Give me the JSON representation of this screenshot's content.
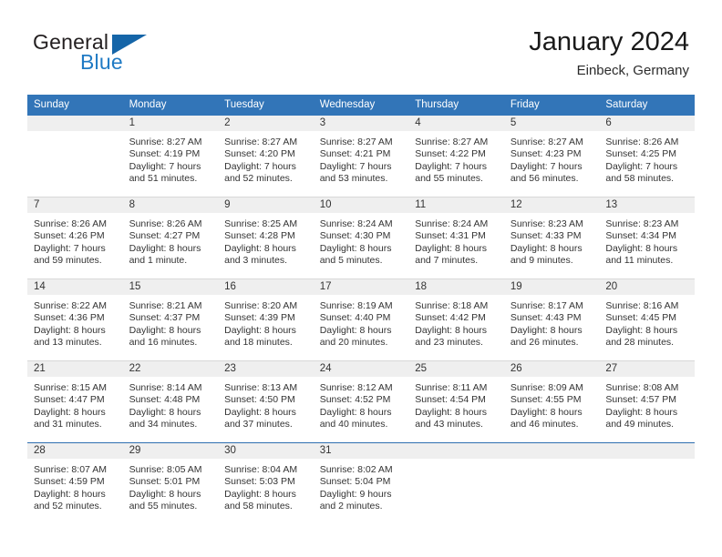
{
  "brand": {
    "name_part1": "General",
    "name_part2": "Blue",
    "accent_color": "#1f7ac4",
    "logo_icon": "triangle-logo-icon"
  },
  "header": {
    "title": "January 2024",
    "subtitle": "Einbeck, Germany"
  },
  "calendar": {
    "header_bg": "#3275b8",
    "daynum_bg": "#efefef",
    "weekday_headers": [
      "Sunday",
      "Monday",
      "Tuesday",
      "Wednesday",
      "Thursday",
      "Friday",
      "Saturday"
    ],
    "weeks": [
      [
        {
          "day": "",
          "sunrise": "",
          "sunset": "",
          "daylight_line1": "",
          "daylight_line2": ""
        },
        {
          "day": "1",
          "sunrise": "Sunrise: 8:27 AM",
          "sunset": "Sunset: 4:19 PM",
          "daylight_line1": "Daylight: 7 hours",
          "daylight_line2": "and 51 minutes."
        },
        {
          "day": "2",
          "sunrise": "Sunrise: 8:27 AM",
          "sunset": "Sunset: 4:20 PM",
          "daylight_line1": "Daylight: 7 hours",
          "daylight_line2": "and 52 minutes."
        },
        {
          "day": "3",
          "sunrise": "Sunrise: 8:27 AM",
          "sunset": "Sunset: 4:21 PM",
          "daylight_line1": "Daylight: 7 hours",
          "daylight_line2": "and 53 minutes."
        },
        {
          "day": "4",
          "sunrise": "Sunrise: 8:27 AM",
          "sunset": "Sunset: 4:22 PM",
          "daylight_line1": "Daylight: 7 hours",
          "daylight_line2": "and 55 minutes."
        },
        {
          "day": "5",
          "sunrise": "Sunrise: 8:27 AM",
          "sunset": "Sunset: 4:23 PM",
          "daylight_line1": "Daylight: 7 hours",
          "daylight_line2": "and 56 minutes."
        },
        {
          "day": "6",
          "sunrise": "Sunrise: 8:26 AM",
          "sunset": "Sunset: 4:25 PM",
          "daylight_line1": "Daylight: 7 hours",
          "daylight_line2": "and 58 minutes."
        }
      ],
      [
        {
          "day": "7",
          "sunrise": "Sunrise: 8:26 AM",
          "sunset": "Sunset: 4:26 PM",
          "daylight_line1": "Daylight: 7 hours",
          "daylight_line2": "and 59 minutes."
        },
        {
          "day": "8",
          "sunrise": "Sunrise: 8:26 AM",
          "sunset": "Sunset: 4:27 PM",
          "daylight_line1": "Daylight: 8 hours",
          "daylight_line2": "and 1 minute."
        },
        {
          "day": "9",
          "sunrise": "Sunrise: 8:25 AM",
          "sunset": "Sunset: 4:28 PM",
          "daylight_line1": "Daylight: 8 hours",
          "daylight_line2": "and 3 minutes."
        },
        {
          "day": "10",
          "sunrise": "Sunrise: 8:24 AM",
          "sunset": "Sunset: 4:30 PM",
          "daylight_line1": "Daylight: 8 hours",
          "daylight_line2": "and 5 minutes."
        },
        {
          "day": "11",
          "sunrise": "Sunrise: 8:24 AM",
          "sunset": "Sunset: 4:31 PM",
          "daylight_line1": "Daylight: 8 hours",
          "daylight_line2": "and 7 minutes."
        },
        {
          "day": "12",
          "sunrise": "Sunrise: 8:23 AM",
          "sunset": "Sunset: 4:33 PM",
          "daylight_line1": "Daylight: 8 hours",
          "daylight_line2": "and 9 minutes."
        },
        {
          "day": "13",
          "sunrise": "Sunrise: 8:23 AM",
          "sunset": "Sunset: 4:34 PM",
          "daylight_line1": "Daylight: 8 hours",
          "daylight_line2": "and 11 minutes."
        }
      ],
      [
        {
          "day": "14",
          "sunrise": "Sunrise: 8:22 AM",
          "sunset": "Sunset: 4:36 PM",
          "daylight_line1": "Daylight: 8 hours",
          "daylight_line2": "and 13 minutes."
        },
        {
          "day": "15",
          "sunrise": "Sunrise: 8:21 AM",
          "sunset": "Sunset: 4:37 PM",
          "daylight_line1": "Daylight: 8 hours",
          "daylight_line2": "and 16 minutes."
        },
        {
          "day": "16",
          "sunrise": "Sunrise: 8:20 AM",
          "sunset": "Sunset: 4:39 PM",
          "daylight_line1": "Daylight: 8 hours",
          "daylight_line2": "and 18 minutes."
        },
        {
          "day": "17",
          "sunrise": "Sunrise: 8:19 AM",
          "sunset": "Sunset: 4:40 PM",
          "daylight_line1": "Daylight: 8 hours",
          "daylight_line2": "and 20 minutes."
        },
        {
          "day": "18",
          "sunrise": "Sunrise: 8:18 AM",
          "sunset": "Sunset: 4:42 PM",
          "daylight_line1": "Daylight: 8 hours",
          "daylight_line2": "and 23 minutes."
        },
        {
          "day": "19",
          "sunrise": "Sunrise: 8:17 AM",
          "sunset": "Sunset: 4:43 PM",
          "daylight_line1": "Daylight: 8 hours",
          "daylight_line2": "and 26 minutes."
        },
        {
          "day": "20",
          "sunrise": "Sunrise: 8:16 AM",
          "sunset": "Sunset: 4:45 PM",
          "daylight_line1": "Daylight: 8 hours",
          "daylight_line2": "and 28 minutes."
        }
      ],
      [
        {
          "day": "21",
          "sunrise": "Sunrise: 8:15 AM",
          "sunset": "Sunset: 4:47 PM",
          "daylight_line1": "Daylight: 8 hours",
          "daylight_line2": "and 31 minutes."
        },
        {
          "day": "22",
          "sunrise": "Sunrise: 8:14 AM",
          "sunset": "Sunset: 4:48 PM",
          "daylight_line1": "Daylight: 8 hours",
          "daylight_line2": "and 34 minutes."
        },
        {
          "day": "23",
          "sunrise": "Sunrise: 8:13 AM",
          "sunset": "Sunset: 4:50 PM",
          "daylight_line1": "Daylight: 8 hours",
          "daylight_line2": "and 37 minutes."
        },
        {
          "day": "24",
          "sunrise": "Sunrise: 8:12 AM",
          "sunset": "Sunset: 4:52 PM",
          "daylight_line1": "Daylight: 8 hours",
          "daylight_line2": "and 40 minutes."
        },
        {
          "day": "25",
          "sunrise": "Sunrise: 8:11 AM",
          "sunset": "Sunset: 4:54 PM",
          "daylight_line1": "Daylight: 8 hours",
          "daylight_line2": "and 43 minutes."
        },
        {
          "day": "26",
          "sunrise": "Sunrise: 8:09 AM",
          "sunset": "Sunset: 4:55 PM",
          "daylight_line1": "Daylight: 8 hours",
          "daylight_line2": "and 46 minutes."
        },
        {
          "day": "27",
          "sunrise": "Sunrise: 8:08 AM",
          "sunset": "Sunset: 4:57 PM",
          "daylight_line1": "Daylight: 8 hours",
          "daylight_line2": "and 49 minutes."
        }
      ],
      [
        {
          "day": "28",
          "sunrise": "Sunrise: 8:07 AM",
          "sunset": "Sunset: 4:59 PM",
          "daylight_line1": "Daylight: 8 hours",
          "daylight_line2": "and 52 minutes."
        },
        {
          "day": "29",
          "sunrise": "Sunrise: 8:05 AM",
          "sunset": "Sunset: 5:01 PM",
          "daylight_line1": "Daylight: 8 hours",
          "daylight_line2": "and 55 minutes."
        },
        {
          "day": "30",
          "sunrise": "Sunrise: 8:04 AM",
          "sunset": "Sunset: 5:03 PM",
          "daylight_line1": "Daylight: 8 hours",
          "daylight_line2": "and 58 minutes."
        },
        {
          "day": "31",
          "sunrise": "Sunrise: 8:02 AM",
          "sunset": "Sunset: 5:04 PM",
          "daylight_line1": "Daylight: 9 hours",
          "daylight_line2": "and 2 minutes."
        },
        {
          "day": "",
          "sunrise": "",
          "sunset": "",
          "daylight_line1": "",
          "daylight_line2": ""
        },
        {
          "day": "",
          "sunrise": "",
          "sunset": "",
          "daylight_line1": "",
          "daylight_line2": ""
        },
        {
          "day": "",
          "sunrise": "",
          "sunset": "",
          "daylight_line1": "",
          "daylight_line2": ""
        }
      ]
    ]
  }
}
